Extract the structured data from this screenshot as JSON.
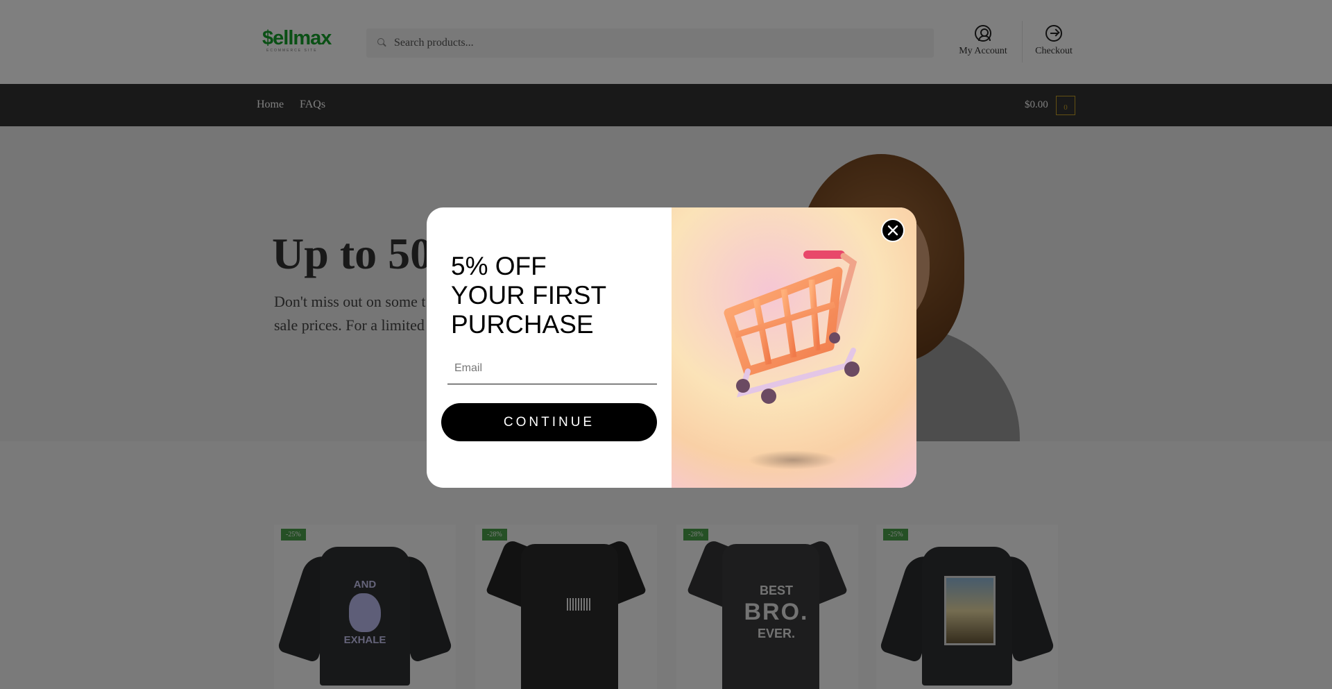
{
  "header": {
    "logo_text": "$ellmax",
    "logo_tagline": "ECOMMERCE SITE",
    "search_placeholder": "Search products...",
    "account_label": "My Account",
    "checkout_label": "Checkout"
  },
  "nav": {
    "items": [
      {
        "label": "Home"
      },
      {
        "label": "FAQs"
      }
    ],
    "cart_total": "$0.00",
    "cart_count": "0"
  },
  "hero": {
    "title": "Up to 50%",
    "subtitle_line1": "Don't miss out on some t",
    "subtitle_line2": "sale prices. For a limited"
  },
  "products": [
    {
      "badge": "-25%",
      "print_top": "AND",
      "print_bottom": "EXHALE"
    },
    {
      "badge": "-28%"
    },
    {
      "badge": "-28%",
      "print_top": "BEST",
      "print_mid": "BRO.",
      "print_bottom": "EVER."
    },
    {
      "badge": "-25%"
    }
  ],
  "modal": {
    "headline": [
      "5% OFF",
      "YOUR FIRST",
      "PURCHASE"
    ],
    "email_placeholder": "Email",
    "continue_label": "CONTINUE"
  },
  "colors": {
    "nav_bg": "#333333",
    "badge_green": "#4aa14a",
    "cart_accent": "#c9a227",
    "button_black": "#000000"
  }
}
